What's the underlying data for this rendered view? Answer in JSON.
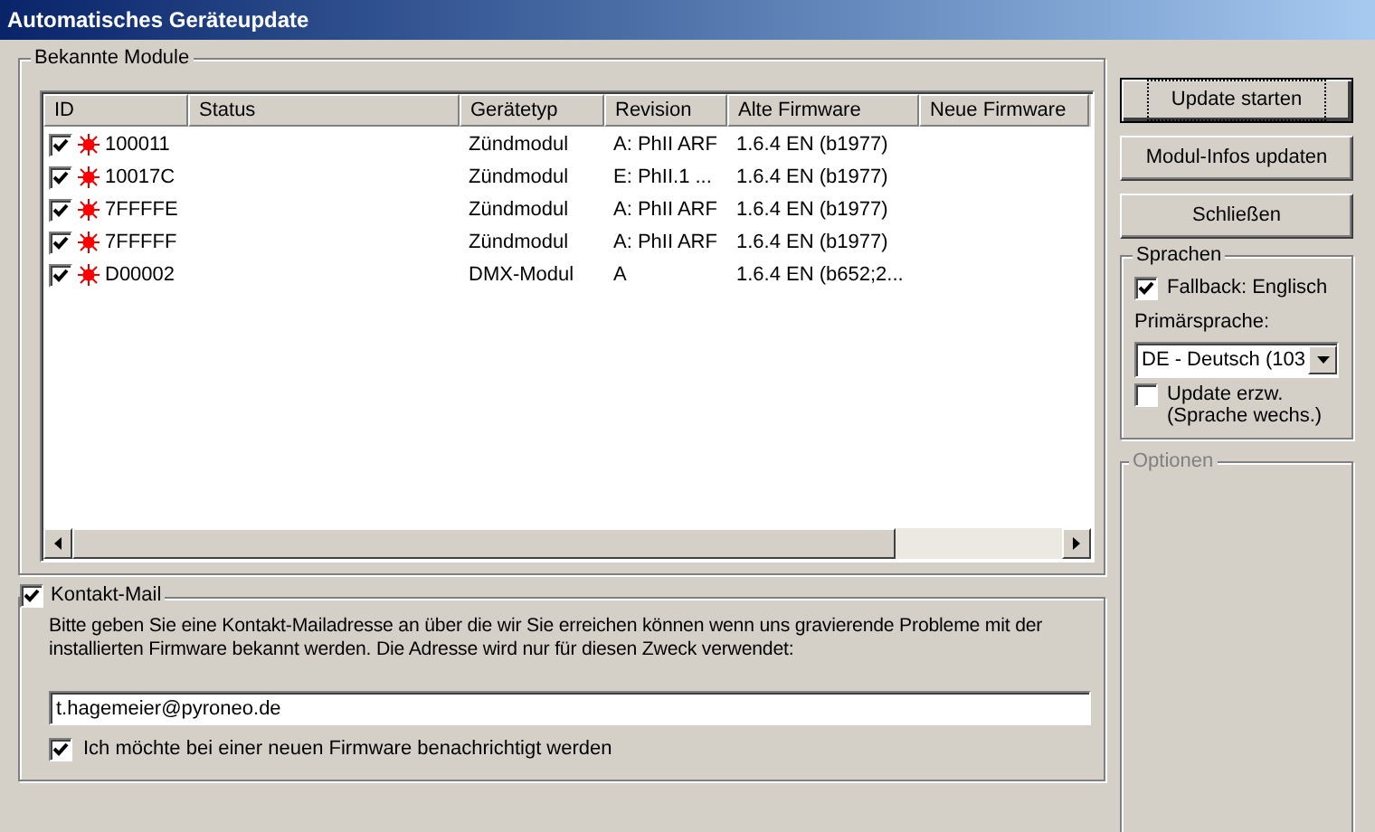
{
  "window": {
    "title": "Automatisches Geräteupdate"
  },
  "modules": {
    "legend": "Bekannte Module",
    "columns": [
      "ID",
      "Status",
      "Gerätetyp",
      "Revision",
      "Alte Firmware",
      "Neue Firmware"
    ],
    "rows": [
      {
        "checked": true,
        "id": "100011",
        "status": "",
        "type": "Zündmodul",
        "revision": "A: PhII ARF",
        "old_firmware": "1.6.4 EN (b1977)"
      },
      {
        "checked": true,
        "id": "10017C",
        "status": "",
        "type": "Zündmodul",
        "revision": "E: PhII.1 ...",
        "old_firmware": "1.6.4 EN (b1977)"
      },
      {
        "checked": true,
        "id": "7FFFFE",
        "status": "",
        "type": "Zündmodul",
        "revision": "A: PhII ARF",
        "old_firmware": "1.6.4 EN (b1977)"
      },
      {
        "checked": true,
        "id": "7FFFFF",
        "status": "",
        "type": "Zündmodul",
        "revision": "A: PhII ARF",
        "old_firmware": "1.6.4 EN (b1977)"
      },
      {
        "checked": true,
        "id": "D00002",
        "status": "",
        "type": "DMX-Modul",
        "revision": "A",
        "old_firmware": "1.6.4 EN (b652;2..."
      }
    ]
  },
  "buttons": [
    {
      "label": "Update starten",
      "focused": true
    },
    {
      "label": "Modul-Infos updaten",
      "focused": false
    },
    {
      "label": "Schließen",
      "focused": false
    }
  ],
  "languages": {
    "legend": "Sprachen",
    "fallback": {
      "label": "Fallback: Englisch",
      "checked": true
    },
    "primary_label": "Primärsprache:",
    "primary_value": "DE - Deutsch (103",
    "extended": {
      "label": "Update erzw. (Sprache wechs.)",
      "checked": false
    }
  },
  "options": {
    "legend": "Optionen"
  },
  "contact": {
    "legend": "Kontakt-Mail",
    "checked": true,
    "description": "Bitte geben Sie eine Kontakt-Mailadresse an über die wir Sie erreichen können wenn uns gravierende Probleme mit der installierten Firmware bekannt werden. Die Adresse wird nur für diesen Zweck verwendet:",
    "email": "t.hagemeier@pyroneo.de",
    "notify": {
      "label": "Ich möchte bei einer neuen Firmware benachrichtigt werden",
      "checked": true
    }
  }
}
